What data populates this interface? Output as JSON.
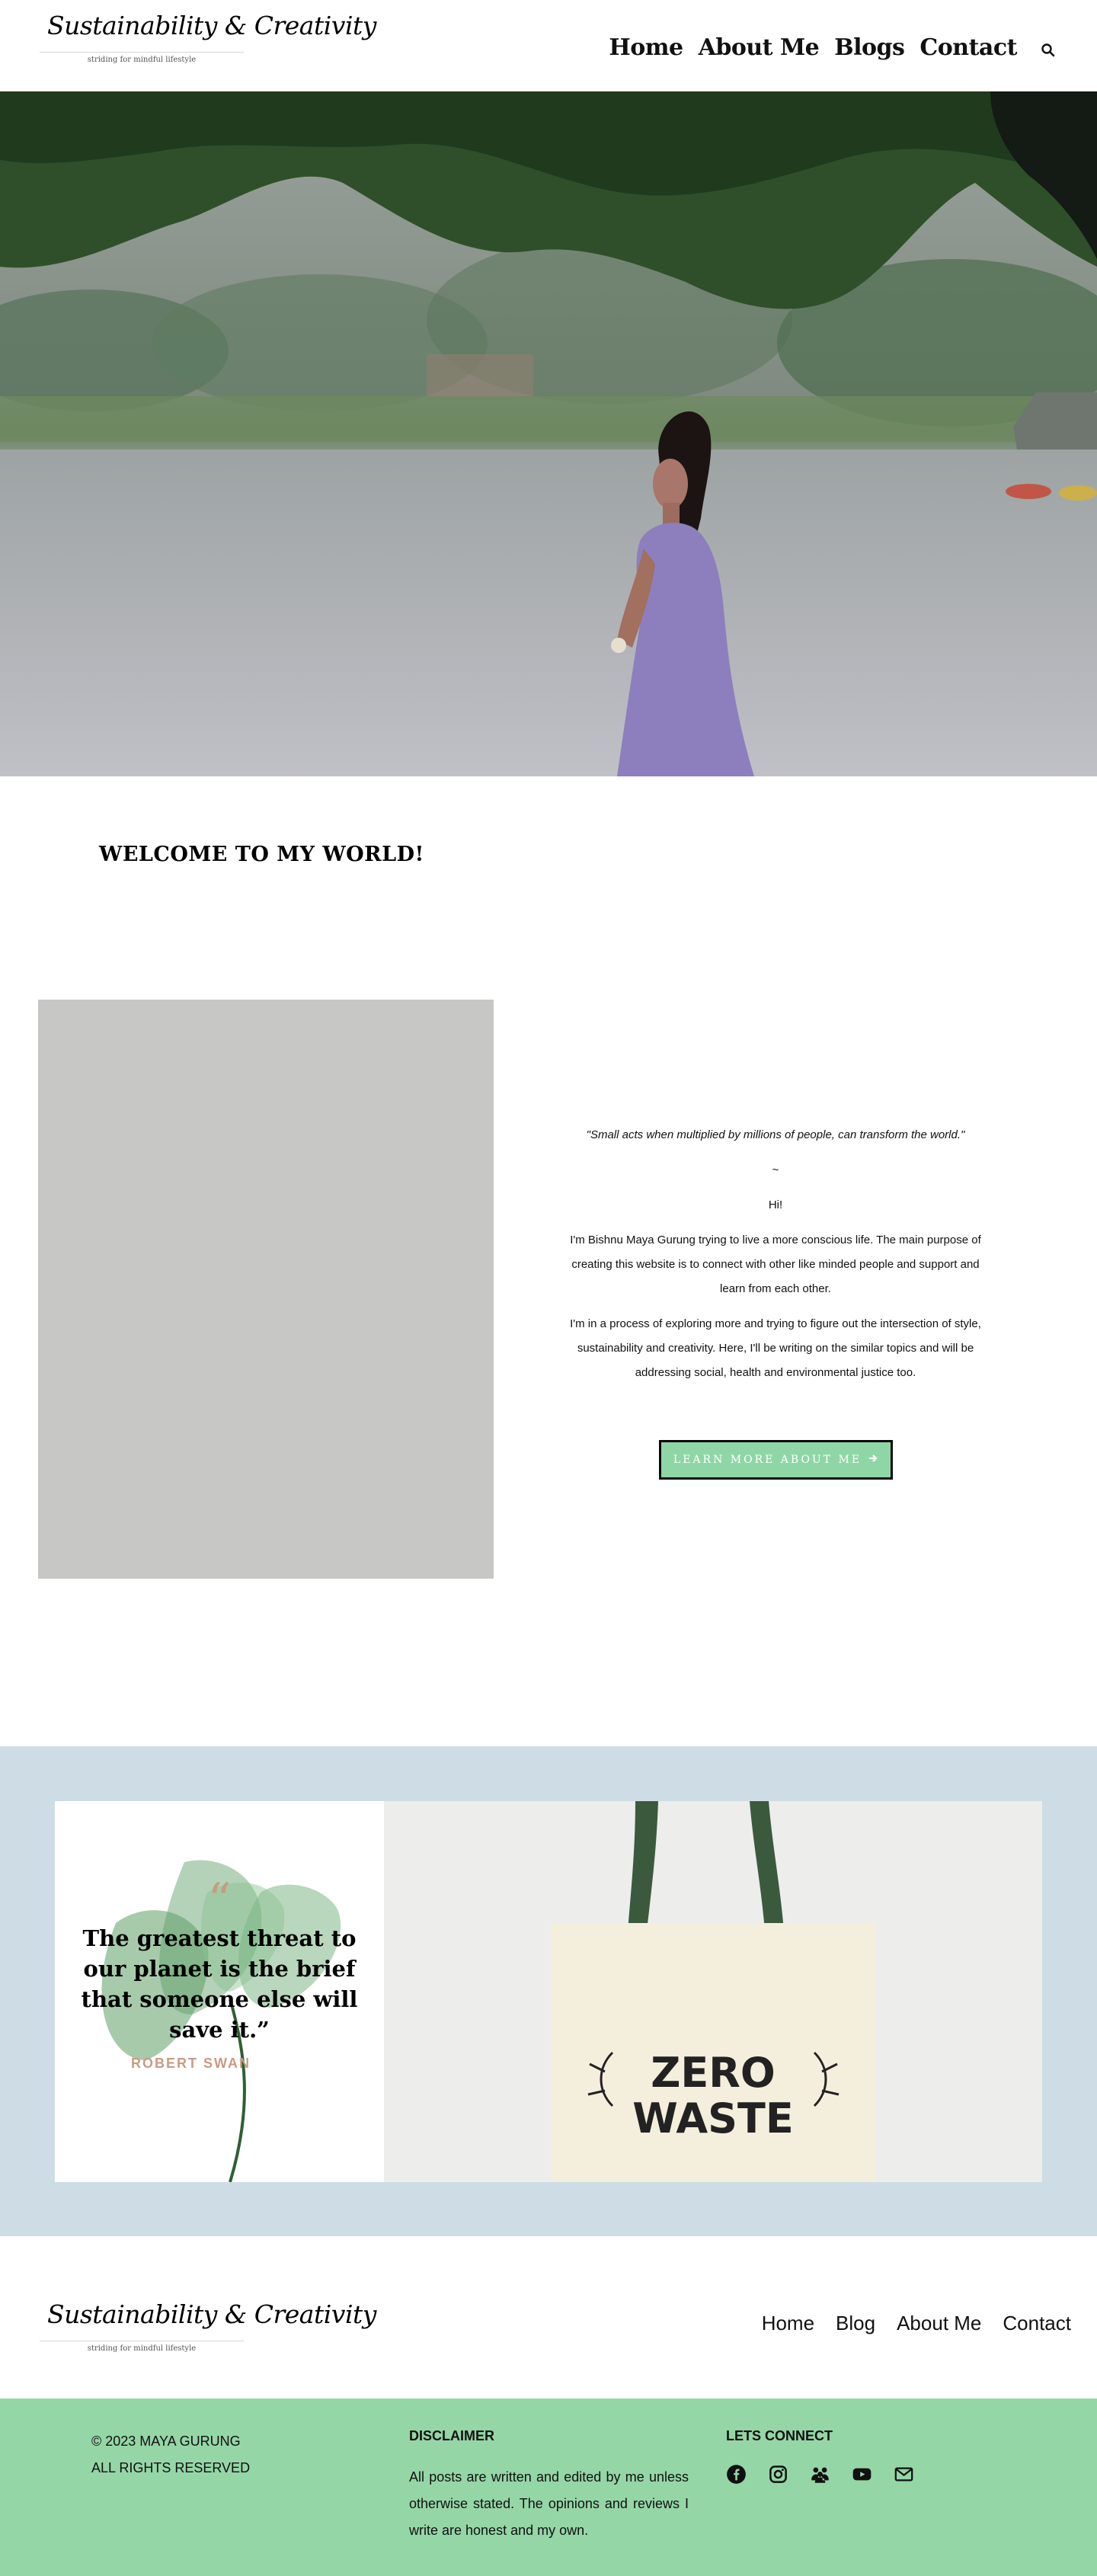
{
  "header": {
    "logo_script": "Sustainability & Creativity",
    "logo_tagline": "striding for mindful lifestyle",
    "nav": [
      "Home",
      "About Me",
      "Blogs",
      "Contact"
    ]
  },
  "welcome": {
    "title": "WELCOME TO MY WORLD!"
  },
  "about": {
    "quote": "\"Small acts when multiplied by millions of people, can transform the world.\"",
    "tilde": "~",
    "greeting": "Hi!",
    "p1": "I'm Bishnu Maya Gurung trying to live a more conscious life. The main purpose of creating this website is to connect with other like minded people and support and learn from each other.",
    "p2": "I'm in a process of exploring more and trying to figure out the intersection of style, sustainability and creativity. Here, I'll be writing on the similar topics and will be addressing  social, health and environmental justice too.",
    "button_label": "LEARN MORE ABOUT ME"
  },
  "quote_section": {
    "quote_mark": "“",
    "quote": "The greatest threat to our planet is the brief that someone else will save it.”",
    "author": "ROBERT SWAN",
    "bag_text_1": "ZERO",
    "bag_text_2": "WASTE"
  },
  "footer": {
    "logo_script": "Sustainability & Creativity",
    "logo_tagline": "striding for mindful lifestyle",
    "nav": [
      "Home",
      "Blog",
      "About Me",
      "Contact"
    ],
    "copyright_1": "© 2023 MAYA GURUNG",
    "copyright_2": "ALL RIGHTS RESERVED",
    "disclaimer_title": "DISCLAIMER",
    "disclaimer_text": "All posts are written and edited by me unless otherwise stated. The opinions and reviews I write are honest and my own.",
    "connect_title": "LETS CONNECT",
    "social_icons": [
      "facebook-icon",
      "instagram-icon",
      "group-icon",
      "youtube-icon",
      "email-icon"
    ]
  },
  "colors": {
    "accent_green": "#95d6a7",
    "button_green": "#8fd6a7",
    "section_blue": "#cedde5",
    "author_color": "#c89b82"
  }
}
